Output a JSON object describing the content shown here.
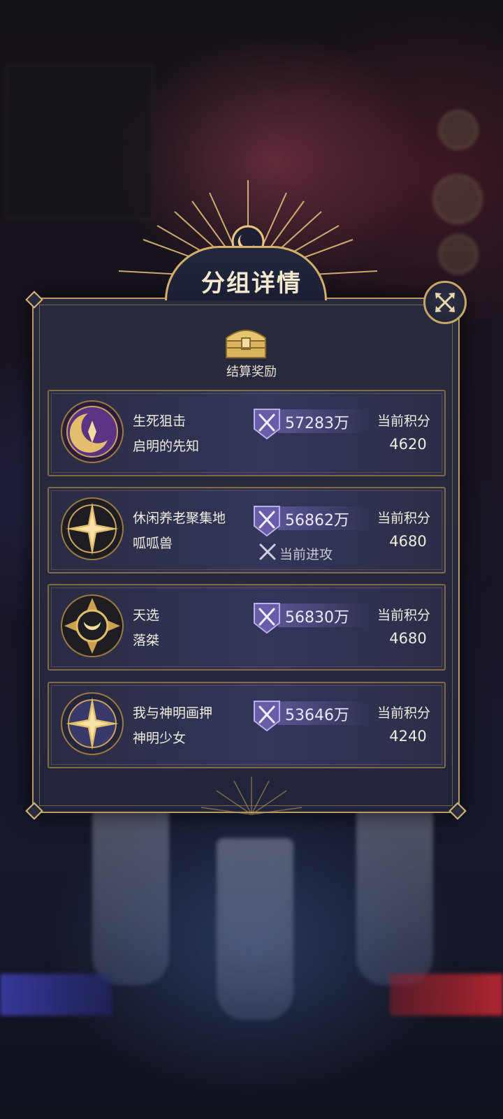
{
  "dialog": {
    "title": "分组详情",
    "reward_label": "结算奖励",
    "score_label": "当前积分",
    "attack_status": "当前进攻"
  },
  "groups": [
    {
      "name": "生死狙击",
      "leader": "启明的先知",
      "power": "57283万",
      "score": "4620",
      "emblem": "crescent-moon-emblem",
      "attacking": false
    },
    {
      "name": "休闲养老聚集地",
      "leader": "呱呱兽",
      "power": "56862万",
      "score": "4680",
      "emblem": "compass-star-emblem",
      "attacking": true
    },
    {
      "name": "天选",
      "leader": "落桀",
      "power": "56830万",
      "score": "4680",
      "emblem": "crescent-sun-emblem",
      "attacking": false
    },
    {
      "name": "我与神明画押",
      "leader": "神明少女",
      "power": "53646万",
      "score": "4240",
      "emblem": "compass-star-emblem",
      "attacking": false
    }
  ],
  "colors": {
    "gold": "#d4b06a",
    "panel": "#2a2a3e",
    "power_bar": "#7b6fc4"
  }
}
